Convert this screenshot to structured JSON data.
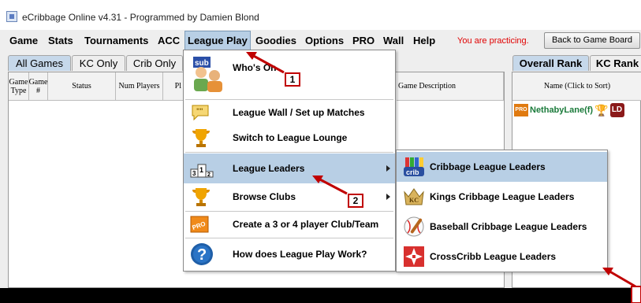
{
  "window": {
    "title": "eCribbage Online v4.31 - Programmed by Damien Blond"
  },
  "menubar": {
    "items": [
      "Game",
      "Stats",
      "Tournaments",
      "ACC",
      "League Play",
      "Goodies",
      "Options",
      "PRO",
      "Wall",
      "Help"
    ],
    "practice_text": "You are practicing.",
    "back_button": "Back to Game Board"
  },
  "left_tabs": [
    "All Games",
    "KC Only",
    "Crib Only"
  ],
  "right_tabs": [
    "Overall Rank",
    "KC Rank"
  ],
  "table_headers": {
    "game_type": "Game Type",
    "game_num": "Game #",
    "status": "Status",
    "num_players": "Num Players",
    "players_partial": "Pl",
    "game_description_partial": "Game Description"
  },
  "rank_header": "Name (Click to Sort)",
  "rank_row": {
    "name": "NethabyLane(f)",
    "badge_pro": "PRO",
    "badge_ld": "LD"
  },
  "league_menu": {
    "whos_on": "Who's On",
    "league_wall": "League Wall / Set up Matches",
    "switch_lounge": "Switch to League Lounge",
    "league_leaders": "League Leaders",
    "browse_clubs": "Browse Clubs",
    "create_club": "Create a 3 or 4 player Club/Team",
    "how_works": "How does League Play Work?"
  },
  "leaders_submenu": [
    "Cribbage League Leaders",
    "Kings Cribbage League Leaders",
    "Baseball Cribbage League Leaders",
    "CrossCribb League Leaders"
  ],
  "callouts": [
    "1",
    "2"
  ],
  "icon_text": {
    "crib": "crib",
    "kc": "KC",
    "pro": "PRO",
    "podium": "1 2 3",
    "quote": "\"\""
  },
  "colors": {
    "selection": "#b8cfe5",
    "annotation_red": "#c00000",
    "practice_red": "#e00000",
    "rank_name_green": "#1a7a3a"
  }
}
